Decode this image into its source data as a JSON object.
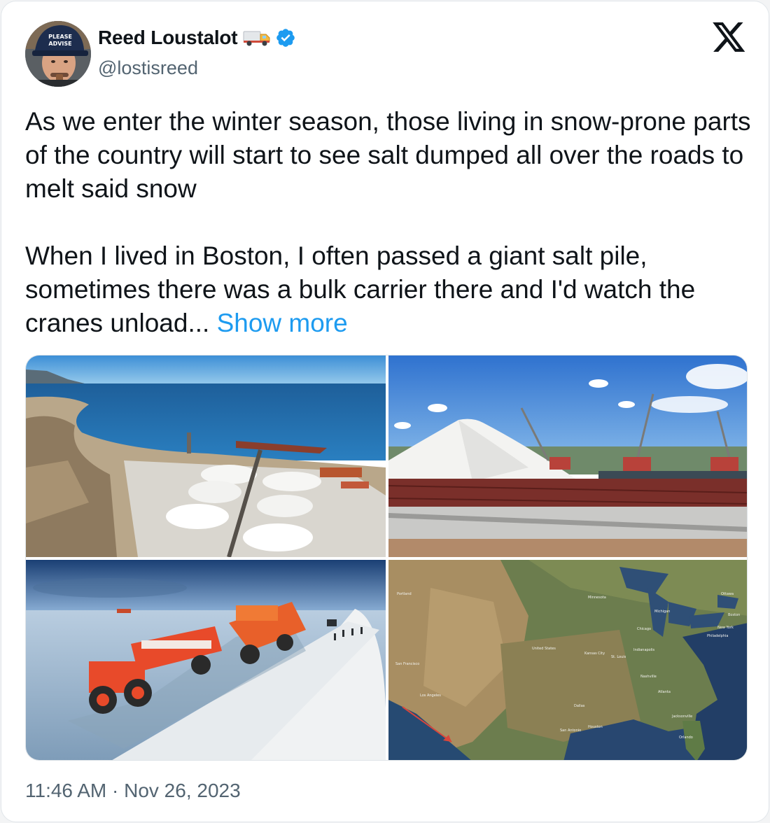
{
  "author": {
    "display_name": "Reed Loustalot",
    "handle": "@lostisreed",
    "name_emoji": "delivery-truck-emoji",
    "verified": true,
    "verified_color": "#1d9bf0",
    "avatar_cap_text": "PLEASE ADVISE"
  },
  "brand": {
    "logo": "x-logo"
  },
  "tweet": {
    "paragraphs": [
      "As we enter the winter season, those living in snow-prone parts of the country will start to see salt dumped all over the roads to melt said snow",
      "When I lived in Boston, I often passed a giant salt pile, sometimes there was a bulk carrier there and I'd watch the cranes unload..."
    ],
    "show_more_label": "Show more",
    "link_color": "#1d9bf0"
  },
  "media": [
    {
      "name": "salt-port-aerial-photo"
    },
    {
      "name": "boston-salt-pile-photo"
    },
    {
      "name": "salt-haul-trucks-photo"
    },
    {
      "name": "us-satellite-map-photo",
      "labels": [
        "United States",
        "Kansas City",
        "St. Louis",
        "Minnesota",
        "Michigan",
        "Chicago",
        "Indianapolis",
        "Nashville",
        "Atlanta",
        "Dallas",
        "San Antonio",
        "Houston",
        "Jacksonville",
        "Orlando",
        "Philadelphia",
        "New York",
        "Boston",
        "Ottawa",
        "Los Angeles",
        "San Francisco",
        "Portland"
      ]
    }
  ],
  "timestamp": "11:46 AM · Nov 26, 2023"
}
